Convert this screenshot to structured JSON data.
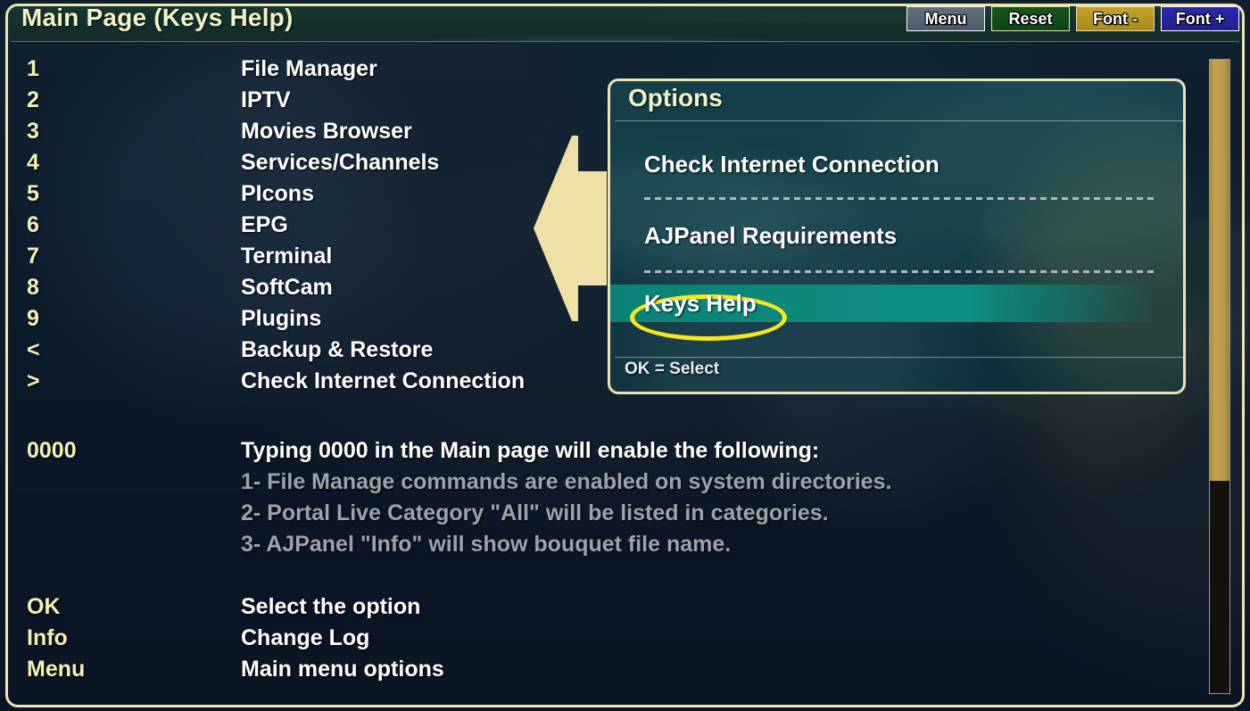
{
  "window": {
    "title": "Main Page (Keys Help)",
    "frame_color": "#efe3b4",
    "background_color": "#0b1628"
  },
  "toolbar": {
    "buttons": [
      {
        "label": "Menu",
        "color": "#4a5a6b"
      },
      {
        "label": "Reset",
        "color": "#0e4517"
      },
      {
        "label": "Font -",
        "color": "#a88a1c"
      },
      {
        "label": "Font +",
        "color": "#1e1e90"
      }
    ]
  },
  "keys_list": [
    {
      "key": "1",
      "desc": "File Manager"
    },
    {
      "key": "2",
      "desc": "IPTV"
    },
    {
      "key": "3",
      "desc": "Movies Browser"
    },
    {
      "key": "4",
      "desc": "Services/Channels"
    },
    {
      "key": "5",
      "desc": "PIcons"
    },
    {
      "key": "6",
      "desc": "EPG"
    },
    {
      "key": "7",
      "desc": "Terminal"
    },
    {
      "key": "8",
      "desc": "SoftCam"
    },
    {
      "key": "9",
      "desc": "Plugins"
    },
    {
      "key": "<",
      "desc": "Backup & Restore"
    },
    {
      "key": ">",
      "desc": "Check Internet Connection"
    }
  ],
  "zero_section": {
    "key": "0000",
    "heading": "Typing 0000 in the Main page will enable the following:",
    "lines": [
      "1- File Manage commands are enabled on system directories.",
      "2- Portal Live Category \"All\" will be listed in categories.",
      "3- AJPanel \"Info\" will show bouquet file name."
    ]
  },
  "footer_keys": [
    {
      "key": "OK",
      "desc": "Select the option"
    },
    {
      "key": "Info",
      "desc": "Change Log"
    },
    {
      "key": "Menu",
      "desc": "Main menu options"
    }
  ],
  "scrollbar": {
    "thumb_percent": 66.5,
    "thumb_color": "#b9994a",
    "track_color": "#15100a"
  },
  "dialog": {
    "title": "Options",
    "items": [
      {
        "label": "Check Internet Connection",
        "selected": false
      },
      {
        "label": "AJPanel Requirements",
        "selected": false
      },
      {
        "label": "Keys Help",
        "selected": true
      }
    ],
    "footer": "OK = Select",
    "highlight_color": "#0d8a7d",
    "border_color": "#efe3b4"
  },
  "annotations": {
    "arrow": {
      "name": "left-pointing-arrow",
      "color": "#efe0a8"
    },
    "ellipse": {
      "name": "highlight-ellipse",
      "color": "#f7e81a",
      "targets": "Keys Help"
    }
  }
}
